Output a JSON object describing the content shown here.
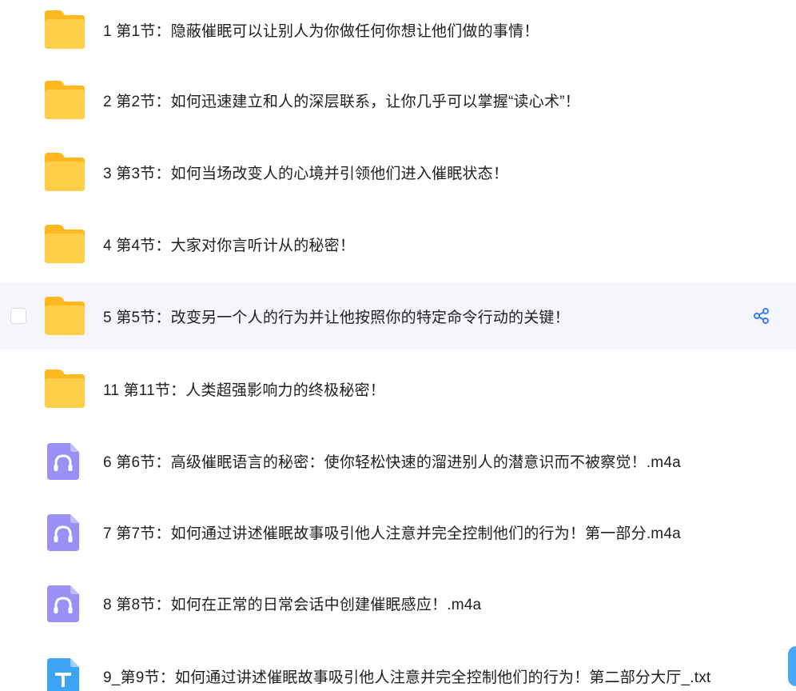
{
  "files": [
    {
      "type": "folder",
      "name": "1 第1节：隐蔽催眠可以让别人为你做任何你想让他们做的事情！",
      "icon": "folder-icon"
    },
    {
      "type": "folder",
      "name": "2 第2节：如何迅速建立和人的深层联系，让你几乎可以掌握“读心术”！",
      "icon": "folder-icon"
    },
    {
      "type": "folder",
      "name": "3 第3节：如何当场改变人的心境并引领他们进入催眠状态！",
      "icon": "folder-icon"
    },
    {
      "type": "folder",
      "name": "4 第4节：大家对你言听计从的秘密！",
      "icon": "folder-icon"
    },
    {
      "type": "folder",
      "name": "5 第5节：改变另一个人的行为并让他按照你的特定命令行动的关键！",
      "icon": "folder-icon",
      "hovered": true
    },
    {
      "type": "folder",
      "name": "11 第11节：人类超强影响力的终极秘密！",
      "icon": "folder-icon"
    },
    {
      "type": "audio",
      "name": "6 第6节：高级催眠语言的秘密：使你轻松快速的溜进别人的潜意识而不被察觉！.m4a",
      "icon": "headphones-icon"
    },
    {
      "type": "audio",
      "name": "7 第7节：如何通过讲述催眠故事吸引他人注意并完全控制他们的行为！第一部分.m4a",
      "icon": "headphones-icon"
    },
    {
      "type": "audio",
      "name": "8 第8节：如何在正常的日常会话中创建催眠感应！.m4a",
      "icon": "headphones-icon"
    },
    {
      "type": "text",
      "name": "9_第9节：如何通过讲述催眠故事吸引他人注意并完全控制他们的行为！第二部分大厅_.txt",
      "icon": "text-file-icon"
    }
  ],
  "colors": {
    "folder": "#ffc93c",
    "folder_tab": "#ffb81f",
    "audio": "#9a90f5",
    "text_file": "#3ba4f5",
    "hover_bg": "#f4f6fb",
    "share": "#3b7bf6"
  },
  "share_icon": "share-icon"
}
